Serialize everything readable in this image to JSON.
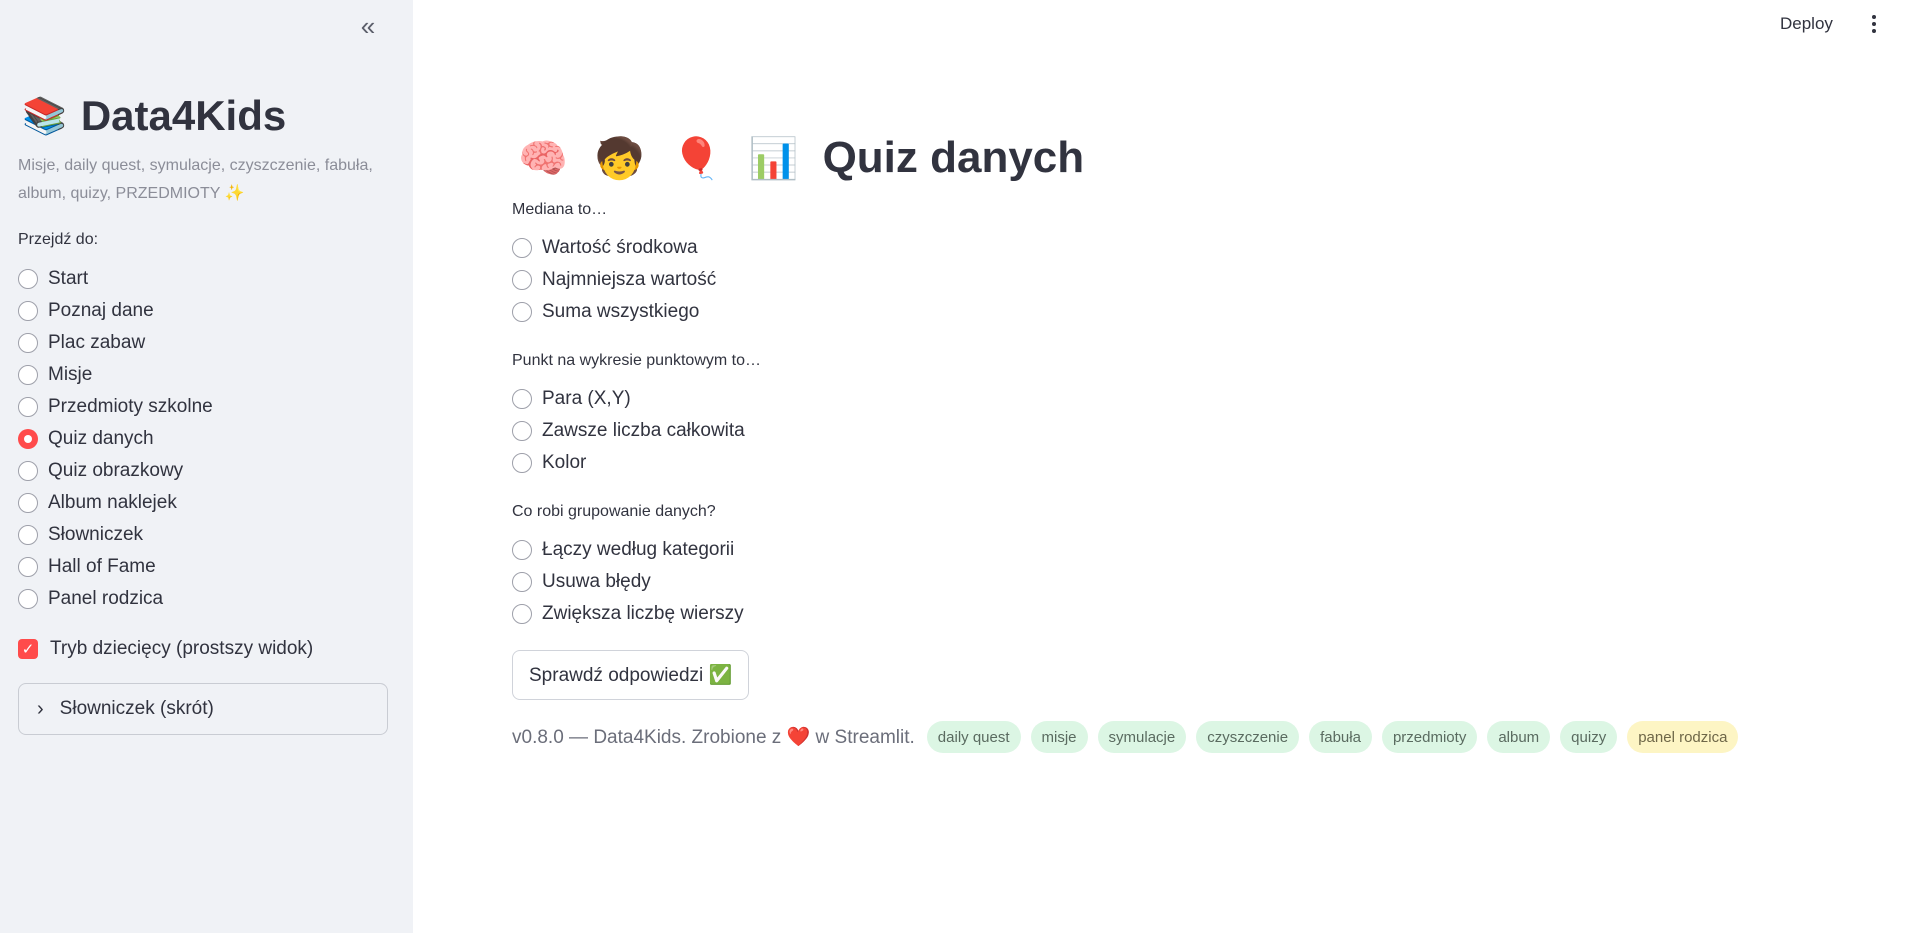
{
  "sidebar": {
    "collapse_icon": "«",
    "title_emoji": "📚",
    "title": "Data4Kids",
    "caption": "Misje, daily quest, symulacje, czyszczenie, fabuła, album, quizy, PRZEDMIOTY ✨",
    "nav_label": "Przejdź do:",
    "nav_items": [
      {
        "label": "Start"
      },
      {
        "label": "Poznaj dane"
      },
      {
        "label": "Plac zabaw"
      },
      {
        "label": "Misje"
      },
      {
        "label": "Przedmioty szkolne"
      },
      {
        "label": "Quiz danych",
        "selected": true
      },
      {
        "label": "Quiz obrazkowy"
      },
      {
        "label": "Album naklejek"
      },
      {
        "label": "Słowniczek"
      },
      {
        "label": "Hall of Fame"
      },
      {
        "label": "Panel rodzica"
      }
    ],
    "kid_mode_label": "Tryb dziecięcy (prostszy widok)",
    "kid_mode_checked": true,
    "expander_label": "Słowniczek (skrót)"
  },
  "header": {
    "deploy_label": "Deploy",
    "menu_icon": "kebab-menu-icon"
  },
  "main": {
    "title_emojis": "🧠 🧒 🎈 📊",
    "title": "Quiz danych",
    "questions": [
      {
        "text": "Mediana to…",
        "options": [
          "Wartość środkowa",
          "Najmniejsza wartość",
          "Suma wszystkiego"
        ]
      },
      {
        "text": "Punkt na wykresie punktowym to…",
        "options": [
          "Para (X,Y)",
          "Zawsze liczba całkowita",
          "Kolor"
        ]
      },
      {
        "text": "Co robi grupowanie danych?",
        "options": [
          "Łączy według kategorii",
          "Usuwa błędy",
          "Zwiększa liczbę wierszy"
        ]
      }
    ],
    "check_button": "Sprawdź odpowiedzi ✅",
    "footer": {
      "before_heart": "v0.8.0 — Data4Kids. Zrobione z ",
      "heart": "❤️",
      "after_heart": " w Streamlit.",
      "tags": [
        "daily quest",
        "misje",
        "symulacje",
        "czyszczenie",
        "fabuła",
        "przedmioty",
        "album",
        "quizy"
      ],
      "parent_tag": "panel rodzica"
    }
  },
  "colors": {
    "accent": "#ff4b4b",
    "sidebar_bg": "#f0f2f6",
    "tag_green": "#dcf6e4",
    "tag_yellow": "#fdf5c4"
  }
}
